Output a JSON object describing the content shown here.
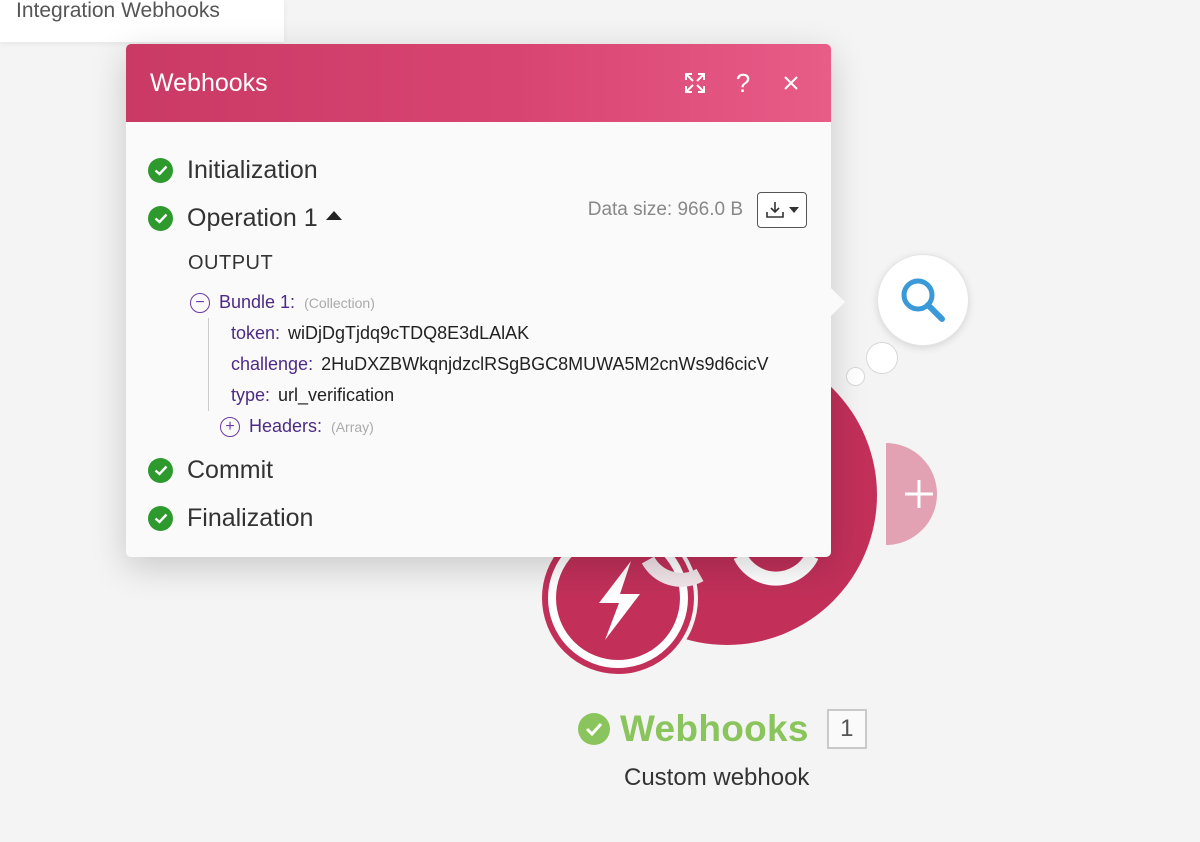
{
  "scenario": {
    "title": "Integration Webhooks"
  },
  "popup": {
    "title": "Webhooks",
    "stages": {
      "initialization": "Initialization",
      "operation": "Operation 1",
      "commit": "Commit",
      "finalization": "Finalization"
    },
    "data_size": "Data size: 966.0 B",
    "output_label": "OUTPUT",
    "bundle": {
      "label": "Bundle 1:",
      "type": "(Collection)",
      "fields": [
        {
          "key": "token:",
          "value": "wiDjDgTjdq9cTDQ8E3dLAlAK"
        },
        {
          "key": "challenge:",
          "value": "2HuDXZBWkqnjdzclRSgBGC8MUWA5M2cnWs9d6cicV"
        },
        {
          "key": "type:",
          "value": "url_verification"
        }
      ],
      "headers": {
        "label": "Headers:",
        "type": "(Array)"
      }
    }
  },
  "module": {
    "name": "Webhooks",
    "badge": "1",
    "subtitle": "Custom webhook",
    "add_glyph": "+",
    "brand_color": "#c2305a",
    "success_color": "#8ac45c"
  }
}
